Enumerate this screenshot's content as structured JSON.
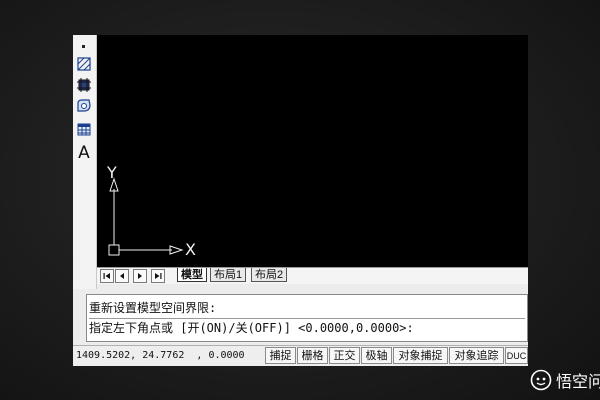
{
  "toolbar": {
    "items": [
      {
        "icon": "small-square-icon"
      },
      {
        "icon": "hatch-icon"
      },
      {
        "icon": "boundary-hatch-icon"
      },
      {
        "icon": "region-icon"
      },
      {
        "icon": "table-icon"
      },
      {
        "icon": "multiline-text-icon",
        "glyph": "A"
      }
    ]
  },
  "canvas": {
    "background": "#000000",
    "ucs": {
      "y_label": "Y",
      "x_label": "X"
    }
  },
  "tabs": {
    "items": [
      {
        "label": "模型",
        "active": true
      },
      {
        "label": "布局1",
        "active": false
      },
      {
        "label": "布局2",
        "active": false
      }
    ]
  },
  "command": {
    "line1": "重新设置模型空间界限:",
    "line2": "指定左下角点或 [开(ON)/关(OFF)] <0.0000,0.0000>:"
  },
  "statusbar": {
    "coords": "1409.5202, 24.7762  , 0.0000",
    "buttons": [
      "捕捉",
      "栅格",
      "正交",
      "极轴",
      "对象捕捉",
      "对象追踪",
      "DUC"
    ]
  },
  "watermark": {
    "text": "悟空问答"
  }
}
